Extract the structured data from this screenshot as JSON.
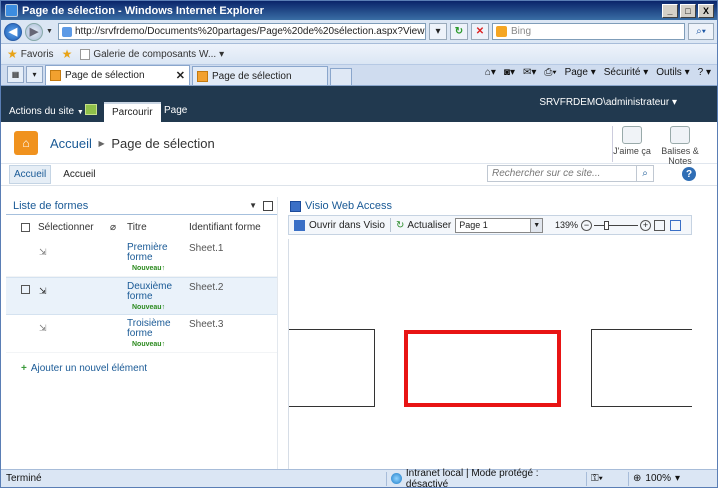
{
  "window": {
    "title": "Page de sélection - Windows Internet Explorer",
    "min": "_",
    "max": "□",
    "close": "X"
  },
  "address_bar": {
    "url": "http://srvfrdemo/Documents%20partages/Page%20de%20sélection.aspx?View={008743FE-EC2",
    "search_placeholder": "Bing"
  },
  "favorites_bar": {
    "favorites_label": "Favoris",
    "link_label": "Galerie de composants W..."
  },
  "tabs": [
    {
      "label": "Page de sélection",
      "active": true
    },
    {
      "label": "Page de sélection",
      "active": false
    }
  ],
  "command_bar": {
    "page": "Page",
    "security": "Sécurité",
    "tools": "Outils",
    "help": "?"
  },
  "sharepoint": {
    "site_actions": "Actions du site",
    "ribbon_tabs": [
      "Parcourir",
      "Page"
    ],
    "user": "SRVFRDEMO\\administrateur",
    "breadcrumb_home": "Accueil",
    "breadcrumb_page": "Page de sélection",
    "like_label": "J'aime ça",
    "tags_label_1": "Balises &",
    "tags_label_2": "Notes",
    "nav_items": [
      "Accueil",
      "Accueil"
    ],
    "search_placeholder": "Rechercher sur ce site...",
    "help": "?"
  },
  "shape_list": {
    "title": "Liste de formes",
    "columns": {
      "select": "Sélectionner",
      "title": "Titre",
      "id": "Identifiant forme"
    },
    "rows": [
      {
        "title": "Première forme",
        "badge": "Nouveau",
        "id": "Sheet.1",
        "highlighted": false
      },
      {
        "title": "Deuxième forme",
        "badge": "Nouveau",
        "id": "Sheet.2",
        "highlighted": true
      },
      {
        "title": "Troisième forme",
        "badge": "Nouveau",
        "id": "Sheet.3",
        "highlighted": false
      }
    ],
    "add_item": "Ajouter un nouvel élément"
  },
  "visio": {
    "title": "Visio Web Access",
    "open_in_visio": "Ouvrir dans Visio",
    "refresh": "Actualiser",
    "page_selected": "Page 1",
    "zoom": "139%",
    "colors": {
      "selection": "#e81414"
    }
  },
  "status_bar": {
    "status": "Terminé",
    "zone": "Intranet local | Mode protégé : désactivé",
    "zoom": "100%"
  }
}
